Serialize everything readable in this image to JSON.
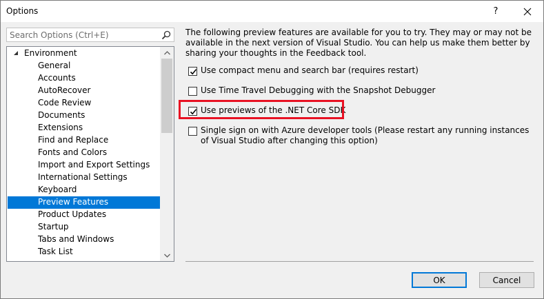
{
  "window": {
    "title": "Options",
    "help_label": "?"
  },
  "search": {
    "placeholder": "Search Options (Ctrl+E)"
  },
  "tree": {
    "root_label": "Environment",
    "items": [
      {
        "label": "General"
      },
      {
        "label": "Accounts"
      },
      {
        "label": "AutoRecover"
      },
      {
        "label": "Code Review"
      },
      {
        "label": "Documents"
      },
      {
        "label": "Extensions"
      },
      {
        "label": "Find and Replace"
      },
      {
        "label": "Fonts and Colors"
      },
      {
        "label": "Import and Export Settings"
      },
      {
        "label": "International Settings"
      },
      {
        "label": "Keyboard"
      },
      {
        "label": "Preview Features",
        "selected": true
      },
      {
        "label": "Product Updates"
      },
      {
        "label": "Startup"
      },
      {
        "label": "Tabs and Windows"
      },
      {
        "label": "Task List"
      }
    ]
  },
  "main": {
    "description": "The following preview features are available for you to try. They may or may not be available in the next version of Visual Studio. You can help us make them better by sharing your thoughts in the Feedback tool.",
    "options": [
      {
        "label": "Use compact menu and search bar (requires restart)",
        "checked": true
      },
      {
        "label": "Use Time Travel Debugging with the Snapshot Debugger",
        "checked": false
      },
      {
        "label": "Use previews of the .NET Core SDK",
        "checked": true
      },
      {
        "label": "Single sign on with Azure developer tools (Please restart any running instances of Visual Studio after changing this option)",
        "checked": false
      }
    ]
  },
  "footer": {
    "ok_label": "OK",
    "cancel_label": "Cancel"
  },
  "colors": {
    "selection": "#0078d7",
    "highlight_box": "#e81123"
  }
}
